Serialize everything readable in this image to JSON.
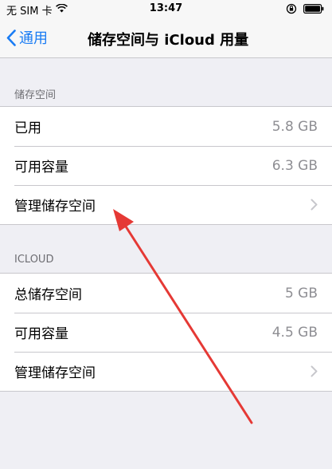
{
  "status_bar": {
    "carrier": "无 SIM 卡",
    "time": "13:47"
  },
  "nav": {
    "back_label": "通用",
    "title": "储存空间与 iCloud 用量"
  },
  "storage_section": {
    "header": "储存空间",
    "rows": [
      {
        "label": "已用",
        "value": "5.8 GB"
      },
      {
        "label": "可用容量",
        "value": "6.3 GB"
      },
      {
        "label": "管理储存空间",
        "value": ""
      }
    ]
  },
  "icloud_section": {
    "header": "ICLOUD",
    "rows": [
      {
        "label": "总储存空间",
        "value": "5 GB"
      },
      {
        "label": "可用容量",
        "value": "4.5 GB"
      },
      {
        "label": "管理储存空间",
        "value": ""
      }
    ]
  },
  "colors": {
    "accent": "#1a7cf4",
    "annotation_arrow": "#e53935",
    "background": "#efeff4"
  },
  "icons": {
    "wifi": "wifi-icon",
    "back": "chevron-left-icon",
    "lock": "orientation-lock-icon",
    "battery": "battery-icon",
    "chevron": "chevron-right-icon"
  }
}
